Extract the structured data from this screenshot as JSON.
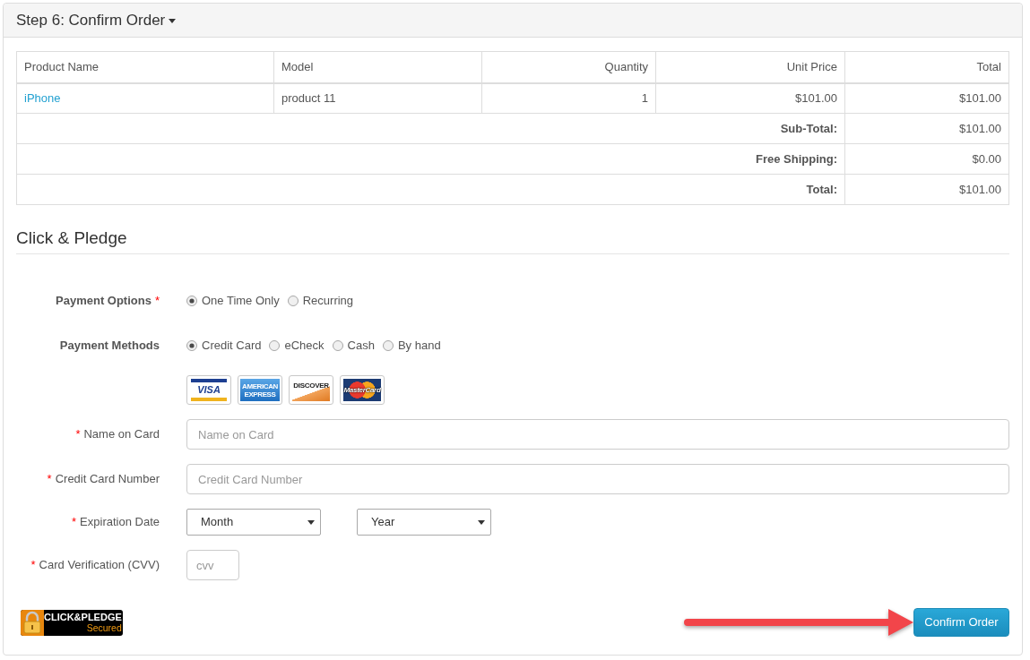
{
  "panel": {
    "title": "Step 6: Confirm Order"
  },
  "order_table": {
    "columns": [
      "Product Name",
      "Model",
      "Quantity",
      "Unit Price",
      "Total"
    ],
    "rows": [
      {
        "product_name": "iPhone",
        "model": "product 11",
        "quantity": "1",
        "unit_price": "$101.00",
        "total": "$101.00"
      }
    ],
    "totals": [
      {
        "label": "Sub-Total:",
        "value": "$101.00"
      },
      {
        "label": "Free Shipping:",
        "value": "$0.00"
      },
      {
        "label": "Total:",
        "value": "$101.00"
      }
    ]
  },
  "payment_section": {
    "title": "Click & Pledge",
    "required_mark": "*",
    "rows": [
      {
        "kind": "radio_group",
        "label": "Payment Options",
        "required": true,
        "options": [
          {
            "label": "One Time Only",
            "selected": true
          },
          {
            "label": "Recurring",
            "selected": false
          }
        ]
      },
      {
        "kind": "radio_group",
        "label": "Payment Methods",
        "required": false,
        "options": [
          {
            "label": "Credit Card",
            "selected": true
          },
          {
            "label": "eCheck",
            "selected": false
          },
          {
            "label": "Cash",
            "selected": false
          },
          {
            "label": "By hand",
            "selected": false
          }
        ]
      },
      {
        "kind": "card_logos",
        "logos": [
          {
            "kind": "visa",
            "text": "VISA"
          },
          {
            "kind": "amex",
            "text": "AMERICAN EXPRESS"
          },
          {
            "kind": "discover",
            "text": "DISCOVER"
          },
          {
            "kind": "mastercard",
            "text": "MasterCard"
          }
        ]
      },
      {
        "kind": "text",
        "label": "Name on Card",
        "required": true,
        "placeholder": "Name on Card"
      },
      {
        "kind": "text",
        "label": "Credit Card Number",
        "required": true,
        "placeholder": "Credit Card Number"
      },
      {
        "kind": "select_pair",
        "label": "Expiration Date",
        "required": true,
        "selects": [
          {
            "value": "Month"
          },
          {
            "value": "Year"
          }
        ]
      },
      {
        "kind": "short_text",
        "label": "Card Verification (CVV)",
        "required": true,
        "placeholder": "cvv"
      }
    ]
  },
  "footer": {
    "badge": {
      "title": "CLICK&PLEDGE",
      "subtitle": "Secured"
    },
    "confirm_button": "Confirm Order"
  }
}
